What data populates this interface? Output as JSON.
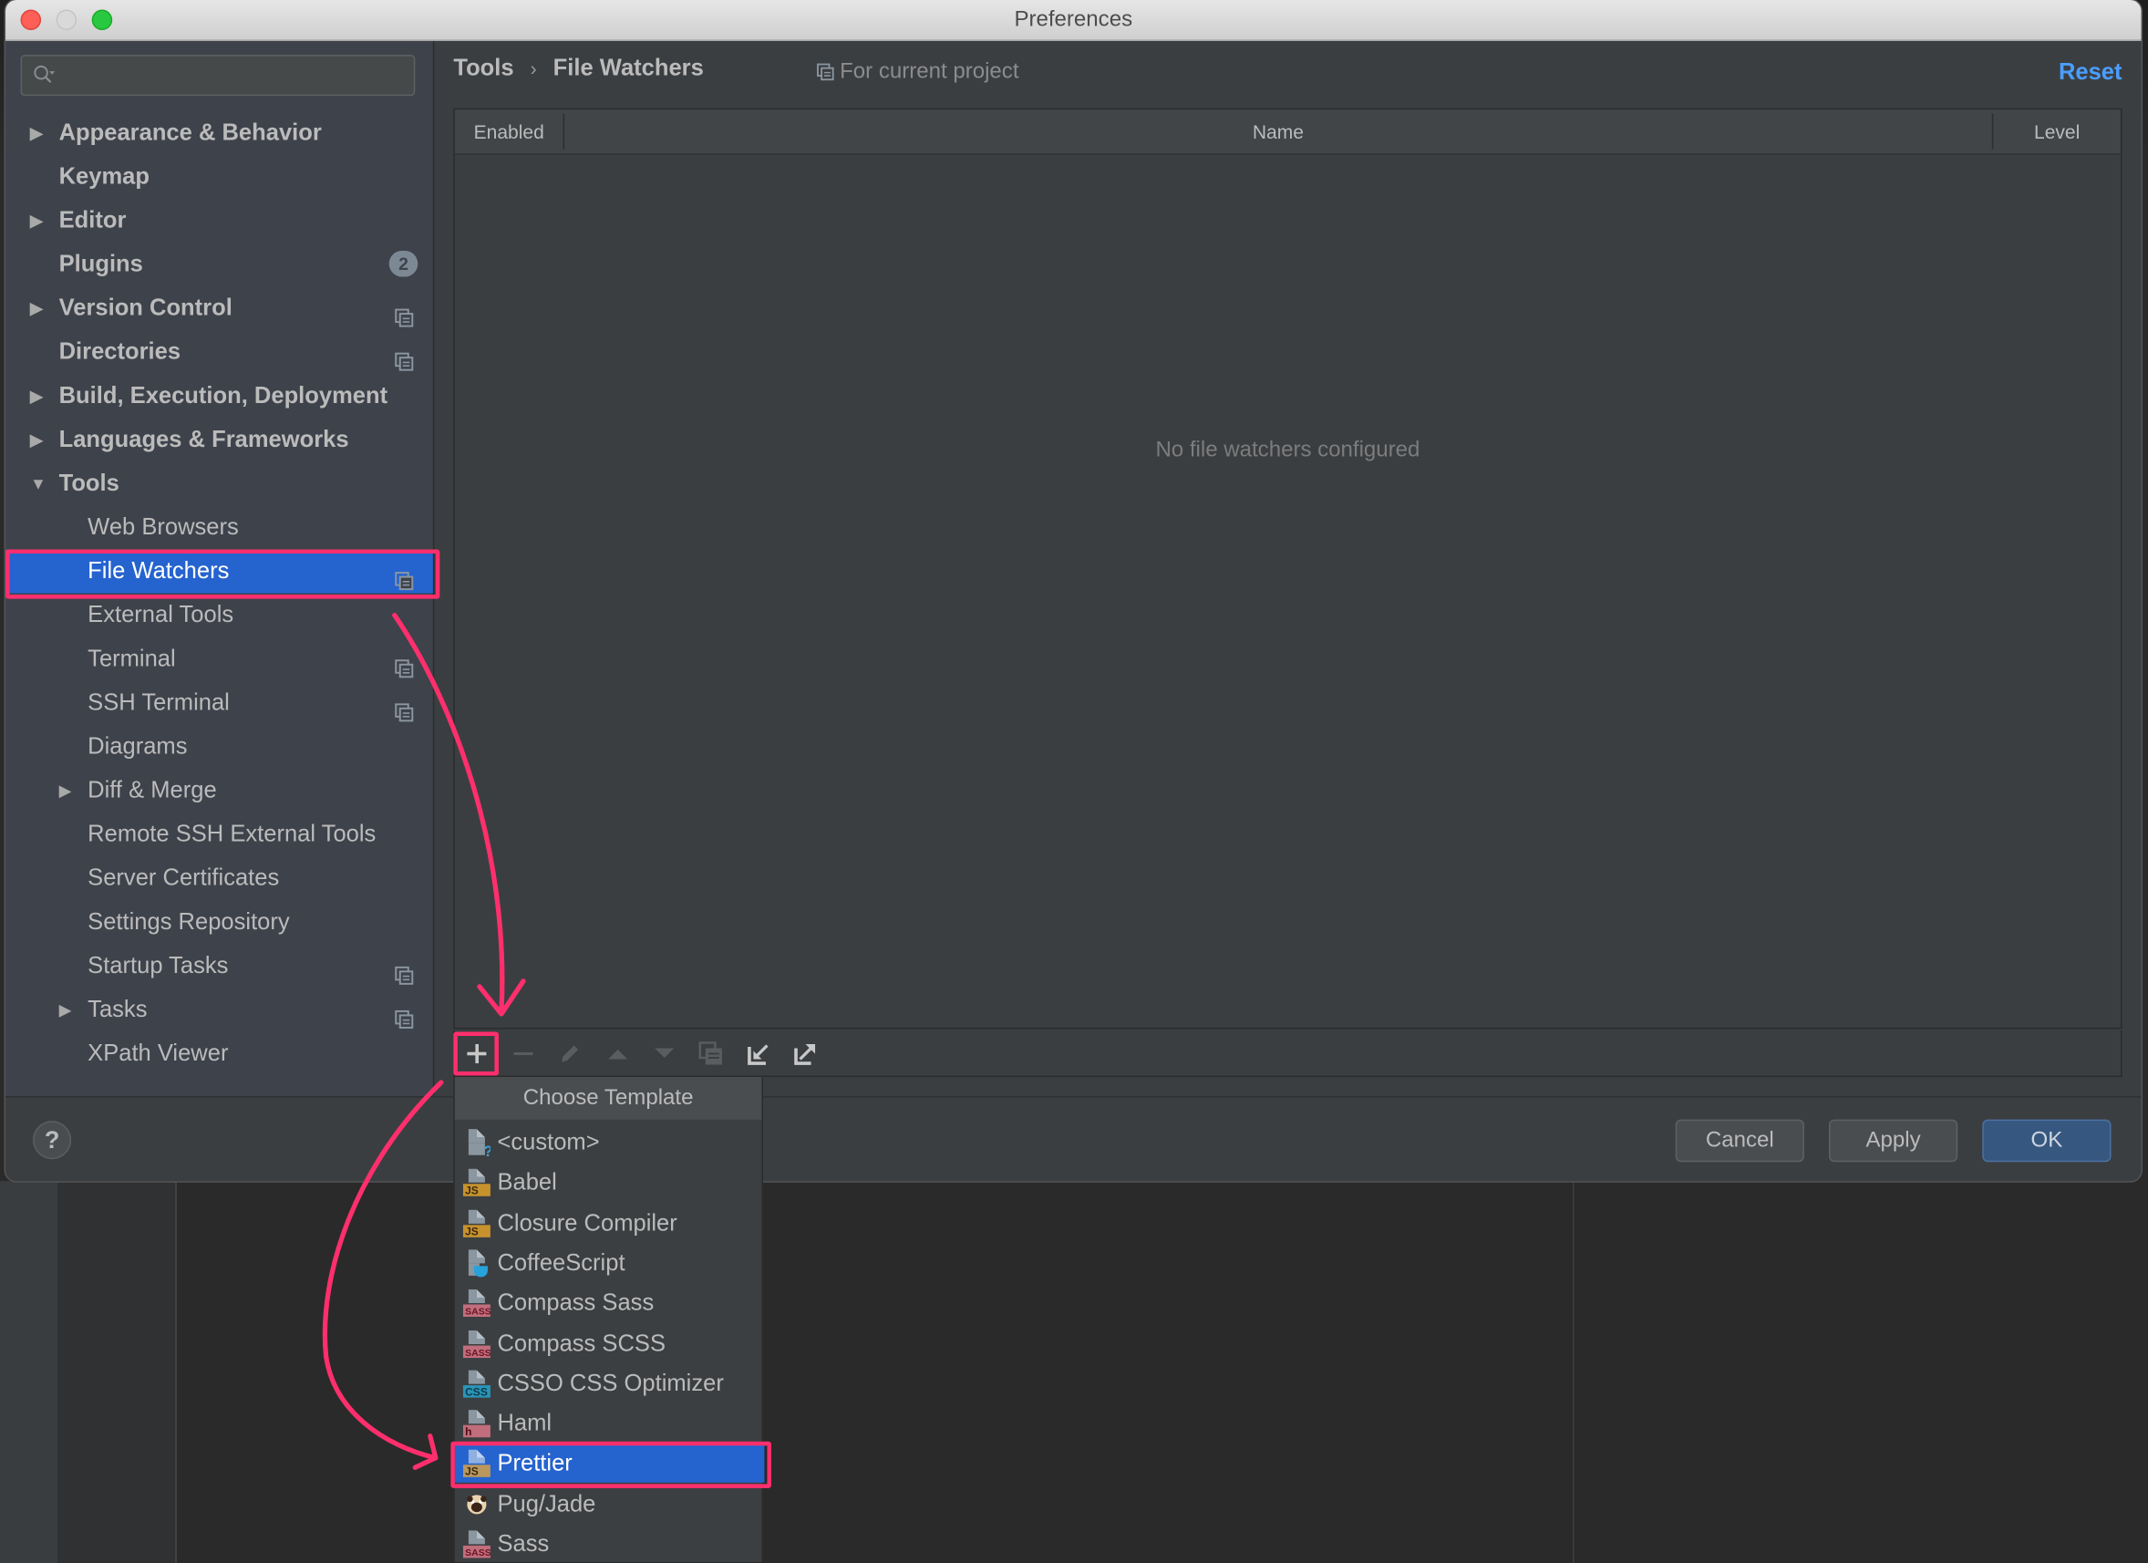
{
  "window": {
    "title": "Preferences"
  },
  "sidebar": {
    "search_placeholder": "",
    "items": [
      {
        "label": "Appearance & Behavior",
        "level": 0,
        "expandable": true,
        "expanded": false,
        "bold": true
      },
      {
        "label": "Keymap",
        "level": 0,
        "expandable": false,
        "bold": true
      },
      {
        "label": "Editor",
        "level": 0,
        "expandable": true,
        "expanded": false,
        "bold": true
      },
      {
        "label": "Plugins",
        "level": 0,
        "expandable": false,
        "bold": true,
        "badge": "2"
      },
      {
        "label": "Version Control",
        "level": 0,
        "expandable": true,
        "expanded": false,
        "bold": true,
        "project_icon": true
      },
      {
        "label": "Directories",
        "level": 0,
        "expandable": false,
        "bold": true,
        "project_icon": true
      },
      {
        "label": "Build, Execution, Deployment",
        "level": 0,
        "expandable": true,
        "expanded": false,
        "bold": true
      },
      {
        "label": "Languages & Frameworks",
        "level": 0,
        "expandable": true,
        "expanded": false,
        "bold": true
      },
      {
        "label": "Tools",
        "level": 0,
        "expandable": true,
        "expanded": true,
        "bold": true
      },
      {
        "label": "Web Browsers",
        "level": 1
      },
      {
        "label": "File Watchers",
        "level": 1,
        "selected": true,
        "project_icon": true
      },
      {
        "label": "External Tools",
        "level": 1
      },
      {
        "label": "Terminal",
        "level": 1,
        "project_icon": true
      },
      {
        "label": "SSH Terminal",
        "level": 1,
        "project_icon": true
      },
      {
        "label": "Diagrams",
        "level": 1
      },
      {
        "label": "Diff & Merge",
        "level": 1,
        "expandable": true,
        "expanded": false
      },
      {
        "label": "Remote SSH External Tools",
        "level": 1
      },
      {
        "label": "Server Certificates",
        "level": 1
      },
      {
        "label": "Settings Repository",
        "level": 1
      },
      {
        "label": "Startup Tasks",
        "level": 1,
        "project_icon": true
      },
      {
        "label": "Tasks",
        "level": 1,
        "expandable": true,
        "expanded": false,
        "project_icon": true
      },
      {
        "label": "XPath Viewer",
        "level": 1
      }
    ]
  },
  "content": {
    "breadcrumb": [
      "Tools",
      "File Watchers"
    ],
    "breadcrumb_separator": "›",
    "scope_label": "For current project",
    "reset_label": "Reset",
    "table": {
      "columns": [
        "Enabled",
        "Name",
        "Level"
      ],
      "rows": [],
      "empty_text": "No file watchers configured"
    },
    "toolbar": [
      {
        "name": "add",
        "icon": "plus-icon",
        "enabled": true
      },
      {
        "name": "remove",
        "icon": "minus-icon",
        "enabled": false
      },
      {
        "name": "edit",
        "icon": "pencil-icon",
        "enabled": false
      },
      {
        "name": "move-up",
        "icon": "arrow-up-icon",
        "enabled": false
      },
      {
        "name": "move-down",
        "icon": "arrow-down-icon",
        "enabled": false
      },
      {
        "name": "copy",
        "icon": "copy-icon",
        "enabled": false
      },
      {
        "name": "import",
        "icon": "import-icon",
        "enabled": true
      },
      {
        "name": "export",
        "icon": "export-icon",
        "enabled": true
      }
    ]
  },
  "popup": {
    "title": "Choose Template",
    "items": [
      {
        "label": "<custom>",
        "icon": "custom",
        "badge": ""
      },
      {
        "label": "Babel",
        "icon": "js",
        "badge": "JS"
      },
      {
        "label": "Closure Compiler",
        "icon": "js",
        "badge": "JS"
      },
      {
        "label": "CoffeeScript",
        "icon": "coffee",
        "badge": ""
      },
      {
        "label": "Compass Sass",
        "icon": "sass",
        "badge": "SASS"
      },
      {
        "label": "Compass SCSS",
        "icon": "sass",
        "badge": "SASS"
      },
      {
        "label": "CSSO CSS Optimizer",
        "icon": "css",
        "badge": "CSS"
      },
      {
        "label": "Haml",
        "icon": "haml",
        "badge": "h"
      },
      {
        "label": "Prettier",
        "icon": "js",
        "badge": "JS",
        "selected": true
      },
      {
        "label": "Pug/Jade",
        "icon": "pug",
        "badge": ""
      },
      {
        "label": "Sass",
        "icon": "sass",
        "badge": "SASS"
      }
    ]
  },
  "footer": {
    "help_label": "?",
    "cancel_label": "Cancel",
    "apply_label": "Apply",
    "ok_label": "OK"
  },
  "colors": {
    "selection": "#2563cf",
    "link": "#4a9eff",
    "annotation": "#ff2f6d",
    "primary_button": "#365880"
  }
}
